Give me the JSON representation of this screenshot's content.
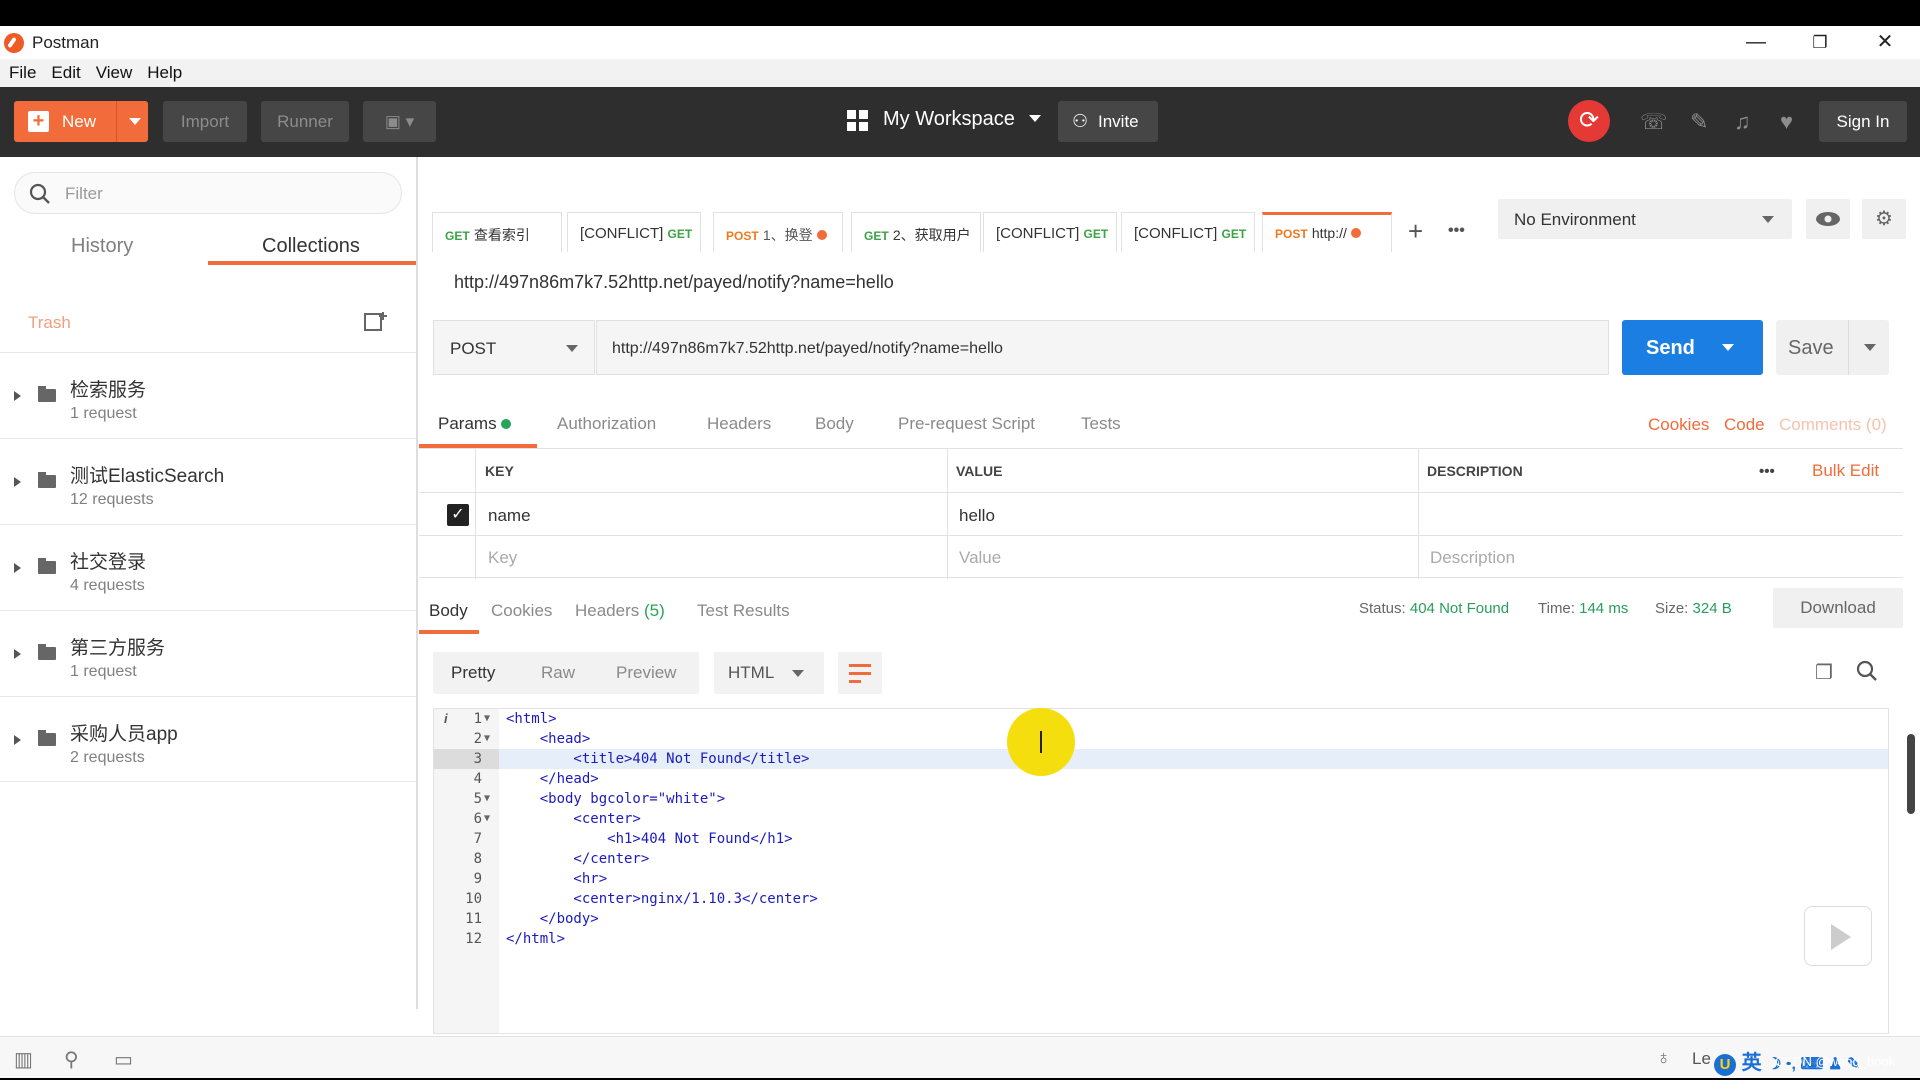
{
  "window": {
    "title": "Postman",
    "minimize": "—",
    "maximize": "❐",
    "close": "✕"
  },
  "menu": [
    "File",
    "Edit",
    "View",
    "Help"
  ],
  "header": {
    "new_label": "New",
    "import_label": "Import",
    "runner_label": "Runner",
    "workspace_label": "My Workspace",
    "invite_label": "Invite",
    "signin_label": "Sign In"
  },
  "sidebar": {
    "filter_placeholder": "Filter",
    "tabs": [
      "History",
      "Collections"
    ],
    "active_tab": "Collections",
    "trash_label": "Trash",
    "folders": [
      {
        "name": "检索服务",
        "count": "1 request"
      },
      {
        "name": "测试ElasticSearch",
        "count": "12 requests"
      },
      {
        "name": "社交登录",
        "count": "4 requests"
      },
      {
        "name": "第三方服务",
        "count": "1 request"
      },
      {
        "name": "采购人员app",
        "count": "2 requests"
      }
    ]
  },
  "request_tabs": [
    {
      "method": "GET",
      "label": "查看索引",
      "dirty": false
    },
    {
      "method": "GET",
      "label": "[CONFLICT]",
      "dirty": false
    },
    {
      "method": "POST",
      "label": "1、换登",
      "dirty": true
    },
    {
      "method": "GET",
      "label": "2、获取用户",
      "dirty": false
    },
    {
      "method": "GET",
      "label": "[CONFLICT]",
      "dirty": false
    },
    {
      "method": "GET",
      "label": "[CONFLICT]",
      "dirty": false
    },
    {
      "method": "POST",
      "label": "http://",
      "dirty": true
    }
  ],
  "environment": {
    "selected": "No Environment"
  },
  "request": {
    "title": "http://497n86m7k7.52http.net/payed/notify?name=hello",
    "method": "POST",
    "url": "http://497n86m7k7.52http.net/payed/notify?name=hello",
    "send_label": "Send",
    "save_label": "Save"
  },
  "param_tabs": [
    "Params",
    "Authorization",
    "Headers",
    "Body",
    "Pre-request Script",
    "Tests"
  ],
  "param_links": {
    "cookies": "Cookies",
    "code": "Code",
    "comments": "Comments (0)"
  },
  "params_table": {
    "headers": {
      "key": "KEY",
      "value": "VALUE",
      "description": "DESCRIPTION",
      "more": "•••",
      "bulk_edit": "Bulk Edit"
    },
    "rows": [
      {
        "key": "name",
        "value": "hello",
        "checked": true
      }
    ],
    "placeholders": {
      "key": "Key",
      "value": "Value",
      "description": "Description"
    }
  },
  "response": {
    "tabs": [
      "Body",
      "Cookies",
      "Headers",
      "(5)",
      "Test Results"
    ],
    "status_label": "Status:",
    "status_value": "404 Not Found",
    "time_label": "Time:",
    "time_value": "144 ms",
    "size_label": "Size:",
    "size_value": "324 B",
    "download_label": "Download",
    "view_modes": [
      "Pretty",
      "Raw",
      "Preview"
    ],
    "format": "HTML",
    "code_lines": [
      "<html>",
      "    <head>",
      "        <title>404 Not Found</title>",
      "    </head>",
      "    <body bgcolor=\"white\">",
      "        <center>",
      "            <h1>404 Not Found</h1>",
      "        </center>",
      "        <hr>",
      "        <center>nginx/1.10.3</center>",
      "    </body>",
      "</html>"
    ],
    "line_numbers": [
      "1",
      "2",
      "3",
      "4",
      "5",
      "6",
      "7",
      "8",
      "9",
      "10",
      "11",
      "12"
    ],
    "info_marker": "i"
  },
  "statusbar": {
    "learn_label": "Le",
    "ime_text": "英",
    "watermark": "CSDN @wang_book"
  },
  "colors": {
    "accent": "#f26b3a",
    "send": "#1a7ee3",
    "header_bg": "#2e2e2e",
    "status_ok": "#2a9d5b"
  }
}
